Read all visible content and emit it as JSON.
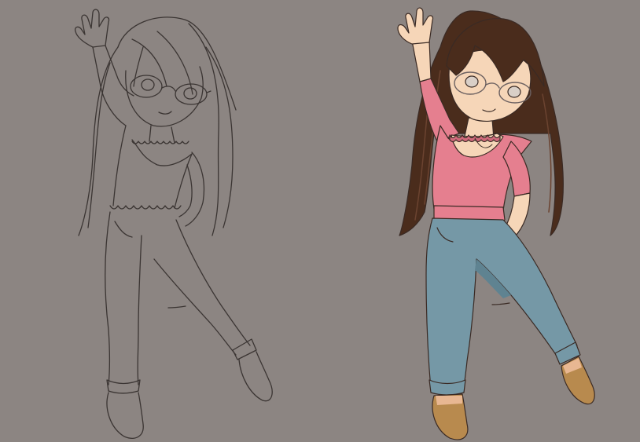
{
  "scene": {
    "background_color": "#8c8582",
    "figures": [
      {
        "name": "line-sketch",
        "style": "uncolored line art",
        "line_color": "#3b3533"
      },
      {
        "name": "colored-drawing",
        "style": "flat colored illustration",
        "line_color": "#3a2a24",
        "palette": {
          "skin": "#f6d6b8",
          "skin_shade": "#e8b792",
          "hair": "#4a2c1c",
          "hair_highlight": "#6b4330",
          "top": "#e57f8f",
          "top_shade": "#cf6a7b",
          "jeans": "#7598a6",
          "jeans_shade": "#5f8391",
          "shoes": "#b88a4e",
          "shoes_shade": "#9a7038",
          "glasses": "#6b6060",
          "eyes": "#d9cfc7"
        }
      }
    ]
  }
}
